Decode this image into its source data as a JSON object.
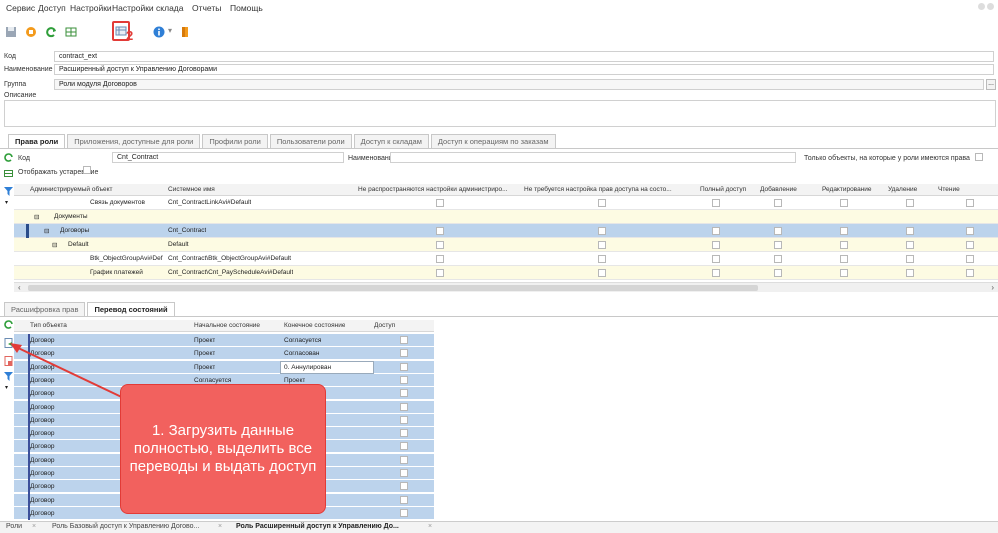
{
  "menu": [
    "Сервис",
    "Доступ",
    "Настройки",
    "Настройки склада",
    "Отчеты",
    "Помощь"
  ],
  "toolbar": {
    "badge": "2",
    "icons": [
      "save-icon",
      "stop-icon",
      "refresh-icon",
      "grid-icon",
      "table-settings-icon",
      "info-icon",
      "exit-icon"
    ]
  },
  "form": {
    "code_label": "Код",
    "code_value": "contract_ext",
    "name_label": "Наименование",
    "name_value": "Расширенный доступ к Управлению Договорами",
    "group_label": "Группа",
    "group_value": "Роли модуля Договоров",
    "desc_label": "Описание",
    "group_btn": "..."
  },
  "top_tabs": [
    "Права роли",
    "Приложения, доступные для роли",
    "Профили роли",
    "Пользователи роли",
    "Доступ к складам",
    "Доступ к операциям по заказам"
  ],
  "filter": {
    "code_label": "Код",
    "code_value": "Cnt_Contract",
    "name_label": "Наименование",
    "only_label": "Только объекты, на которые у роли имеются права",
    "show_old_label": "Отображать устаревшие"
  },
  "rights_grid": {
    "headers": [
      "Администрируемый объект",
      "Системное имя",
      "Не распространяются настройки администриро...",
      "Не требуется настройка прав доступа на состо...",
      "Полный доступ",
      "Добавление",
      "Редактирование",
      "Удаление",
      "Чтение"
    ],
    "rows": [
      {
        "obj": "Связь документов",
        "sys": "Cnt_ContractLinkAvi#Default"
      },
      {
        "obj": "Документы",
        "sys": ""
      },
      {
        "obj": "Договоры",
        "sys": "Cnt_Contract"
      },
      {
        "obj": "Default",
        "sys": "Default"
      },
      {
        "obj": "Btk_ObjectGroupAvi#Def",
        "sys": "Cnt_Contract\\Btk_ObjectGroupAvi#Default"
      },
      {
        "obj": "График платежей",
        "sys": "Cnt_Contract\\Cnt_PayScheduleAvi#Default"
      }
    ]
  },
  "bottom_tabs": [
    "Расшифровка прав",
    "Перевод состояний"
  ],
  "states_grid": {
    "headers": [
      "Тип объекта",
      "Начальное состояние",
      "Конечное состояние",
      "Доступ"
    ],
    "rows": [
      {
        "type": "Договор",
        "start": "Проект",
        "end": "Согласуется"
      },
      {
        "type": "Договор",
        "start": "Проект",
        "end": "Согласован"
      },
      {
        "type": "Договор",
        "start": "Проект",
        "end": "0. Аннулирован"
      },
      {
        "type": "Договор",
        "start": "Согласуется",
        "end": "Проект"
      },
      {
        "type": "Договор",
        "start": "",
        "end": ""
      },
      {
        "type": "Договор",
        "start": "",
        "end": ""
      },
      {
        "type": "Договор",
        "start": "",
        "end": ""
      },
      {
        "type": "Договор",
        "start": "",
        "end": ""
      },
      {
        "type": "Договор",
        "start": "",
        "end": ""
      },
      {
        "type": "Договор",
        "start": "",
        "end": ""
      },
      {
        "type": "Договор",
        "start": "",
        "end": ""
      },
      {
        "type": "Договор",
        "start": "",
        "end": ""
      },
      {
        "type": "Договор",
        "start": "",
        "end": ""
      },
      {
        "type": "Договор",
        "start": "",
        "end": ""
      }
    ]
  },
  "callout": {
    "text": "1. Загрузить данные полностью, выделить все переводы и выдать доступ"
  },
  "window_tabs": [
    "Роли",
    "Роль Базовый доступ к Управлению Догово...",
    "Роль Расширенный доступ к Управлению До..."
  ],
  "colors": {
    "selected": "#bcd3ec",
    "highlight": "#fdfbe3",
    "callout": "#f2615e",
    "accent": "#e23b37"
  }
}
